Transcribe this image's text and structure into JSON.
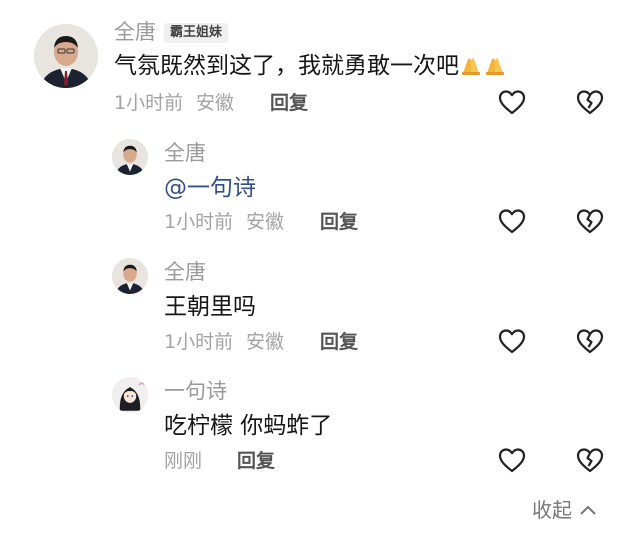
{
  "comments": [
    {
      "author": "全唐",
      "badge": "霸王姐妹",
      "text": "气氛既然到这了，我就勇敢一次吧",
      "emoji": "🙏🙏",
      "time": "1小时前",
      "location": "安徽",
      "reply_label": "回复"
    }
  ],
  "replies": [
    {
      "author": "全唐",
      "text": "@一句诗",
      "time": "1小时前",
      "location": "安徽",
      "reply_label": "回复"
    },
    {
      "author": "全唐",
      "text": "王朝里吗",
      "time": "1小时前",
      "location": "安徽",
      "reply_label": "回复"
    },
    {
      "author": "一句诗",
      "text": "吃柠檬 你蚂蚱了",
      "time": "刚刚",
      "location": "",
      "reply_label": "回复"
    }
  ],
  "collapse_label": "收起",
  "colors": {
    "mention": "#33508c",
    "meta": "#a3a3a3",
    "icon": "#222222"
  },
  "icons": {
    "like": "heart-outline-icon",
    "dislike": "broken-heart-icon",
    "collapse": "chevron-up-icon",
    "emoji": "folded-hands-emoji"
  }
}
